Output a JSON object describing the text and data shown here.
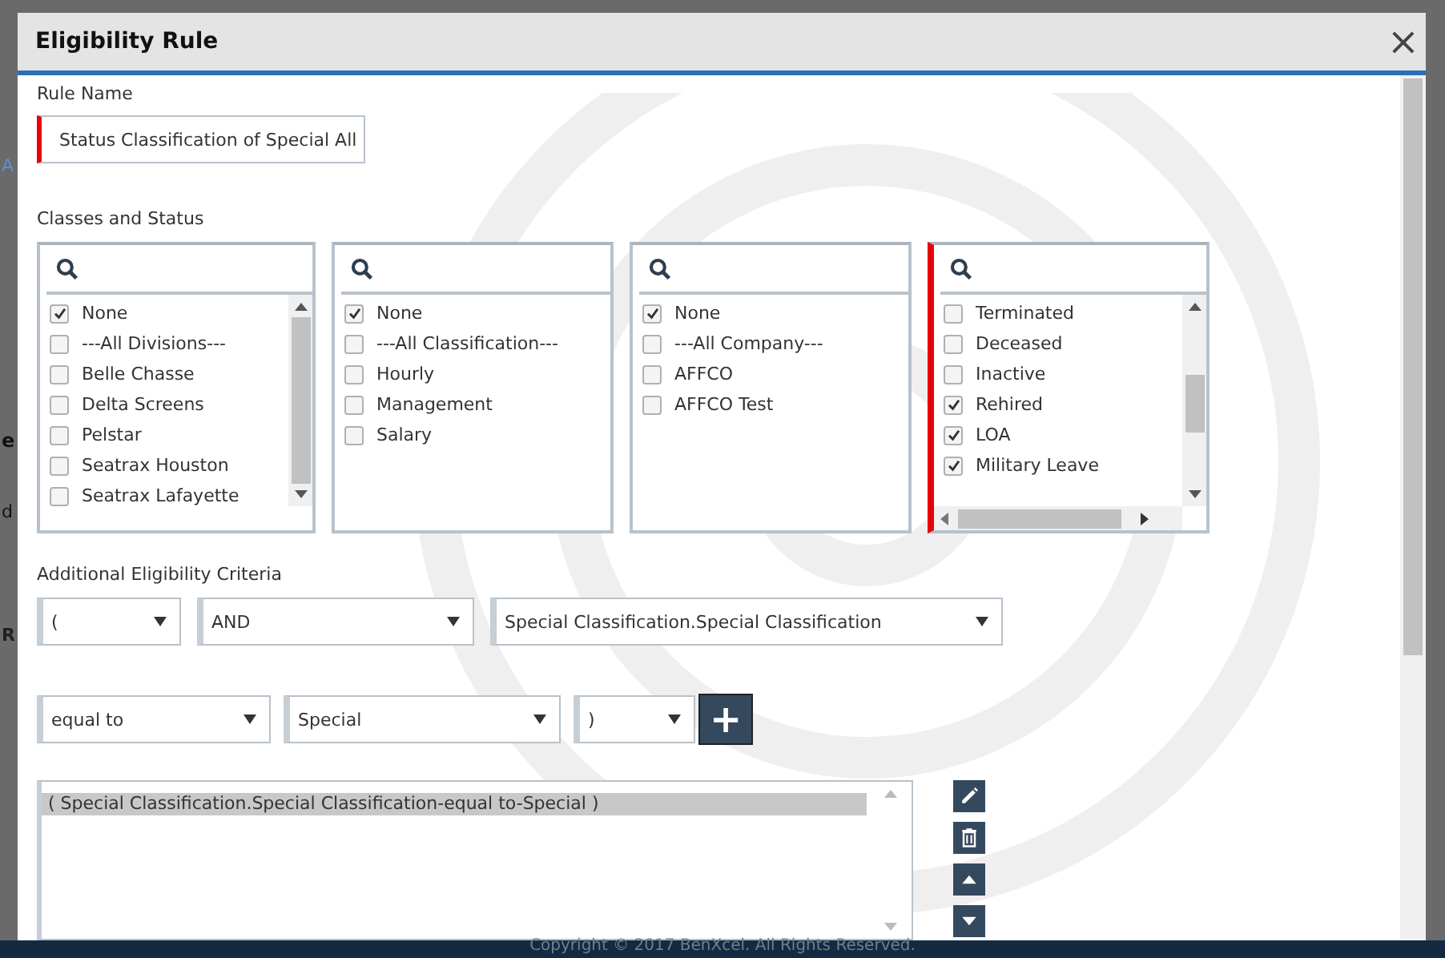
{
  "background": {
    "fragments": [
      "A",
      "e",
      "d",
      "R"
    ],
    "footer": "Copyright © 2017 BenXcel. All Rights Reserved."
  },
  "window": {
    "title": "Eligibility Rule",
    "close": "×"
  },
  "rule_name": {
    "label": "Rule Name",
    "value": "Status Classification of Special All",
    "required": true
  },
  "classes_and_status": {
    "label": "Classes and Status",
    "lists": [
      {
        "required": false,
        "items": [
          {
            "label": "None",
            "checked": true
          },
          {
            "label": "---All Divisions---",
            "checked": false
          },
          {
            "label": "Belle Chasse",
            "checked": false
          },
          {
            "label": "Delta Screens",
            "checked": false
          },
          {
            "label": "Pelstar",
            "checked": false
          },
          {
            "label": "Seatrax Houston",
            "checked": false
          },
          {
            "label": "Seatrax Lafayette",
            "checked": false
          }
        ]
      },
      {
        "required": false,
        "items": [
          {
            "label": "None",
            "checked": true
          },
          {
            "label": "---All Classification---",
            "checked": false
          },
          {
            "label": "Hourly",
            "checked": false
          },
          {
            "label": "Management",
            "checked": false
          },
          {
            "label": "Salary",
            "checked": false
          }
        ]
      },
      {
        "required": false,
        "items": [
          {
            "label": "None",
            "checked": true
          },
          {
            "label": "---All Company---",
            "checked": false
          },
          {
            "label": "AFFCO",
            "checked": false
          },
          {
            "label": "AFFCO Test",
            "checked": false
          }
        ]
      },
      {
        "required": true,
        "items": [
          {
            "label": "Terminated",
            "checked": false
          },
          {
            "label": "Deceased",
            "checked": false
          },
          {
            "label": "Inactive",
            "checked": false
          },
          {
            "label": "Rehired",
            "checked": true
          },
          {
            "label": "LOA",
            "checked": true
          },
          {
            "label": "Military Leave",
            "checked": true
          }
        ]
      }
    ]
  },
  "additional_criteria": {
    "label": "Additional Eligibility Criteria",
    "row_1": [
      {
        "value": "("
      },
      {
        "value": "AND"
      },
      {
        "value": "Special Classification.Special Classification"
      }
    ],
    "row_2": [
      {
        "value": "equal to"
      },
      {
        "value": "Special"
      },
      {
        "value": ")"
      }
    ],
    "add_button": "+",
    "criteria": [
      {
        "text": "( Special Classification.Special Classification-equal to-Special )",
        "selected": true
      }
    ],
    "actions": [
      {
        "kind": "edit"
      },
      {
        "kind": "delete"
      },
      {
        "kind": "up"
      },
      {
        "kind": "down"
      }
    ]
  }
}
